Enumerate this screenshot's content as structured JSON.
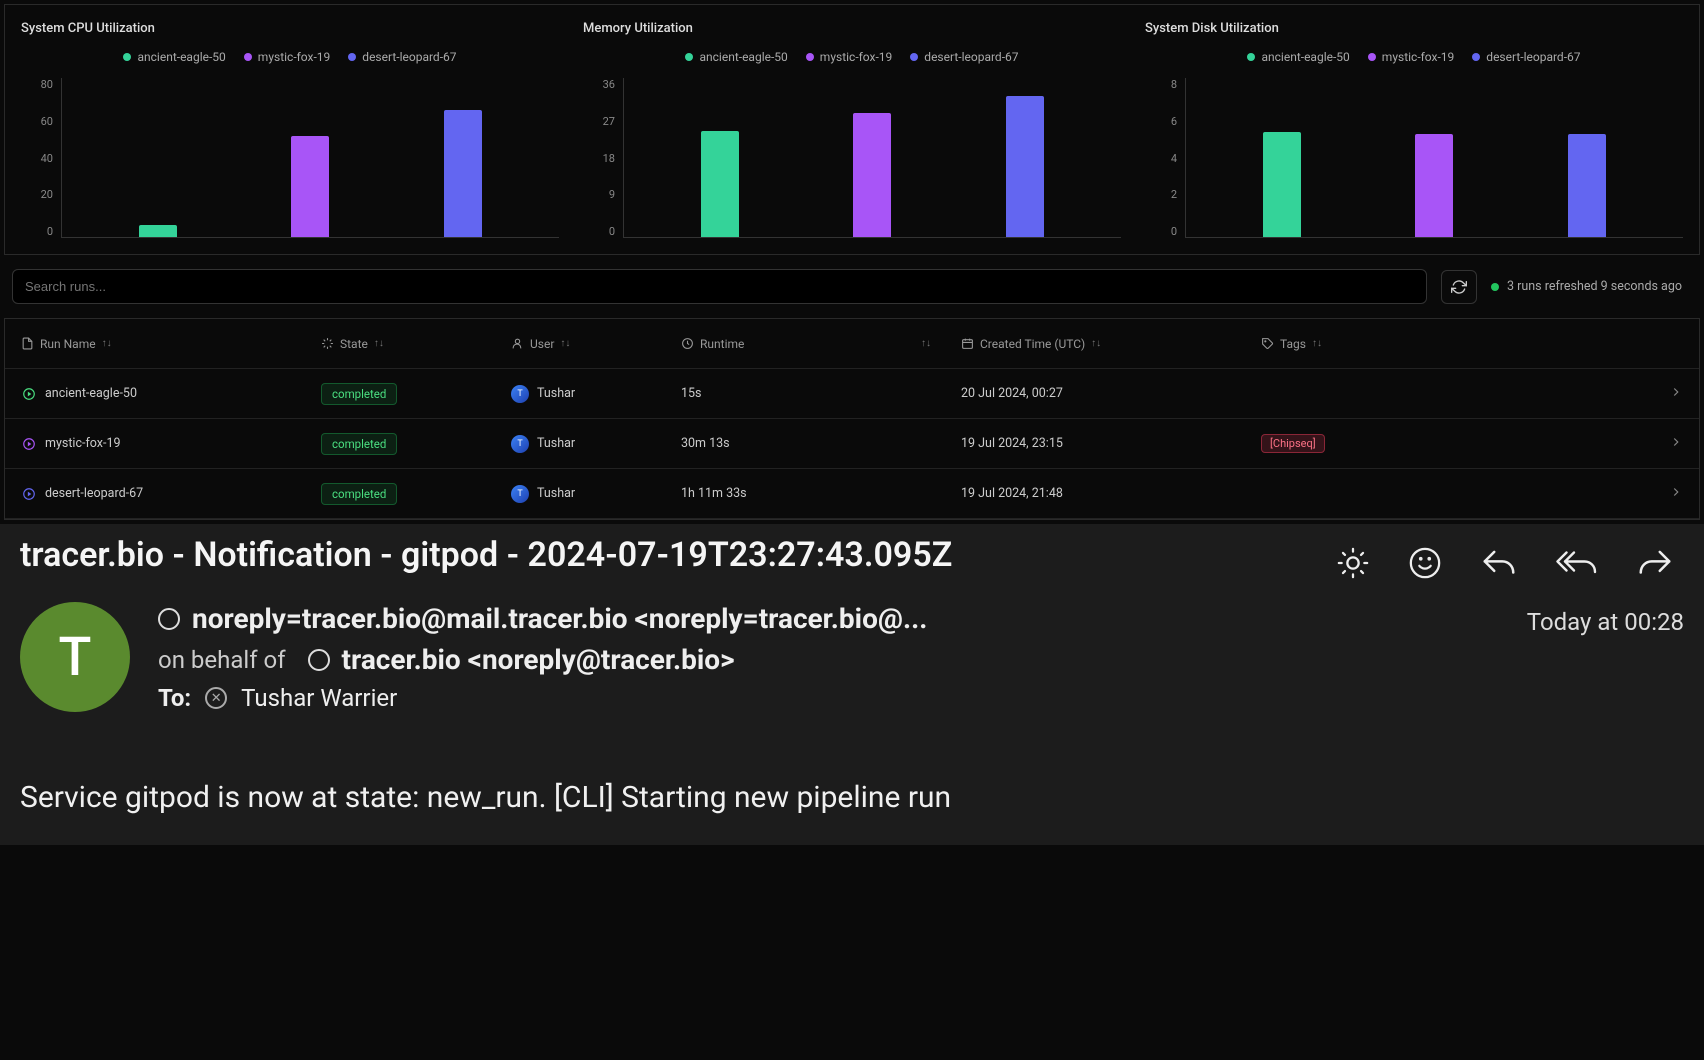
{
  "charts": [
    {
      "title": "System CPU Utilization",
      "legend": [
        {
          "label": "ancient-eagle-50",
          "color": "#34d399"
        },
        {
          "label": "mystic-fox-19",
          "color": "#a855f7"
        },
        {
          "label": "desert-leopard-67",
          "color": "#6366f1"
        }
      ],
      "ymax": 80,
      "yticks": [
        "80",
        "60",
        "40",
        "20",
        "0"
      ],
      "bars": [
        {
          "color": "#34d399",
          "value": 6
        },
        {
          "color": "#a855f7",
          "value": 51
        },
        {
          "color": "#6366f1",
          "value": 64
        }
      ]
    },
    {
      "title": "Memory Utilization",
      "legend": [
        {
          "label": "ancient-eagle-50",
          "color": "#34d399"
        },
        {
          "label": "mystic-fox-19",
          "color": "#a855f7"
        },
        {
          "label": "desert-leopard-67",
          "color": "#6366f1"
        }
      ],
      "ymax": 36,
      "yticks": [
        "36",
        "27",
        "18",
        "9",
        "0"
      ],
      "bars": [
        {
          "color": "#34d399",
          "value": 24
        },
        {
          "color": "#a855f7",
          "value": 28
        },
        {
          "color": "#6366f1",
          "value": 32
        }
      ]
    },
    {
      "title": "System Disk Utilization",
      "legend": [
        {
          "label": "ancient-eagle-50",
          "color": "#34d399"
        },
        {
          "label": "mystic-fox-19",
          "color": "#a855f7"
        },
        {
          "label": "desert-leopard-67",
          "color": "#6366f1"
        }
      ],
      "ymax": 8,
      "yticks": [
        "8",
        "6",
        "4",
        "2",
        "0"
      ],
      "bars": [
        {
          "color": "#34d399",
          "value": 5.3
        },
        {
          "color": "#a855f7",
          "value": 5.2
        },
        {
          "color": "#6366f1",
          "value": 5.2
        }
      ]
    }
  ],
  "chart_data": [
    {
      "type": "bar",
      "title": "System CPU Utilization",
      "categories": [
        "ancient-eagle-50",
        "mystic-fox-19",
        "desert-leopard-67"
      ],
      "values": [
        6,
        51,
        64
      ],
      "ylim": [
        0,
        80
      ],
      "ylabel": "",
      "xlabel": ""
    },
    {
      "type": "bar",
      "title": "Memory Utilization",
      "categories": [
        "ancient-eagle-50",
        "mystic-fox-19",
        "desert-leopard-67"
      ],
      "values": [
        24,
        28,
        32
      ],
      "ylim": [
        0,
        36
      ],
      "ylabel": "",
      "xlabel": ""
    },
    {
      "type": "bar",
      "title": "System Disk Utilization",
      "categories": [
        "ancient-eagle-50",
        "mystic-fox-19",
        "desert-leopard-67"
      ],
      "values": [
        5.3,
        5.2,
        5.2
      ],
      "ylim": [
        0,
        8
      ],
      "ylabel": "",
      "xlabel": ""
    }
  ],
  "search": {
    "placeholder": "Search runs..."
  },
  "refresh_status": "3 runs refreshed 9 seconds ago",
  "table": {
    "columns": {
      "run_name": "Run Name",
      "state": "State",
      "user": "User",
      "runtime": "Runtime",
      "created": "Created Time (UTC)",
      "tags": "Tags"
    },
    "rows": [
      {
        "icon_color": "#4ade80",
        "name": "ancient-eagle-50",
        "state": "completed",
        "user": "Tushar",
        "runtime": "15s",
        "created": "20 Jul 2024, 00:27",
        "tags": []
      },
      {
        "icon_color": "#a855f7",
        "name": "mystic-fox-19",
        "state": "completed",
        "user": "Tushar",
        "runtime": "30m 13s",
        "created": "19 Jul 2024, 23:15",
        "tags": [
          "[Chipseq]"
        ]
      },
      {
        "icon_color": "#6366f1",
        "name": "desert-leopard-67",
        "state": "completed",
        "user": "Tushar",
        "runtime": "1h 11m 33s",
        "created": "19 Jul 2024, 21:48",
        "tags": []
      }
    ]
  },
  "email": {
    "subject": "tracer.bio - Notification - gitpod - 2024-07-19T23:27:43.095Z",
    "avatar_initial": "T",
    "from_display": "noreply=tracer.bio@mail.tracer.bio <noreply=tracer.bio@...",
    "behalf_prefix": "on behalf of",
    "behalf_display": "tracer.bio <noreply@tracer.bio>",
    "to_label": "To:",
    "to_name": "Tushar Warrier",
    "timestamp": "Today at 00:28",
    "body": "Service gitpod is now at state: new_run. [CLI] Starting new pipeline run"
  }
}
